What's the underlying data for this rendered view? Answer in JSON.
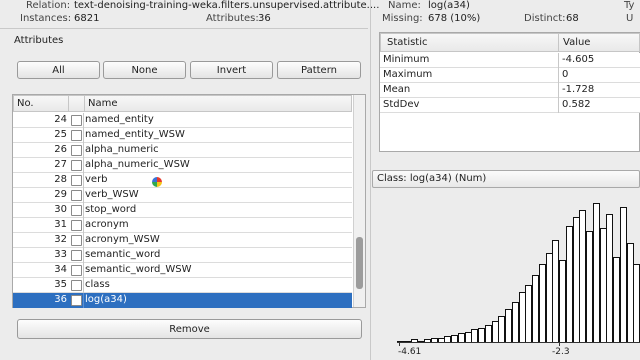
{
  "relation": {
    "label": "Relation:",
    "value": "text-denoising-training-weka.filters.unsupervised.attribute...."
  },
  "instances": {
    "label": "Instances:",
    "value": "6821"
  },
  "attributes_count": {
    "label": "Attributes:",
    "value": "36"
  },
  "attributes_panel": {
    "title": "Attributes",
    "buttons": {
      "all": "All",
      "none": "None",
      "invert": "Invert",
      "pattern": "Pattern"
    },
    "columns": {
      "no": "No.",
      "name": "Name"
    },
    "rows": [
      {
        "no": "24",
        "name": "named_entity"
      },
      {
        "no": "25",
        "name": "named_entity_WSW"
      },
      {
        "no": "26",
        "name": "alpha_numeric"
      },
      {
        "no": "27",
        "name": "alpha_numeric_WSW"
      },
      {
        "no": "28",
        "name": "verb"
      },
      {
        "no": "29",
        "name": "verb_WSW"
      },
      {
        "no": "30",
        "name": "stop_word"
      },
      {
        "no": "31",
        "name": "acronym"
      },
      {
        "no": "32",
        "name": "acronym_WSW"
      },
      {
        "no": "33",
        "name": "semantic_word"
      },
      {
        "no": "34",
        "name": "semantic_word_WSW"
      },
      {
        "no": "35",
        "name": "class"
      },
      {
        "no": "36",
        "name": "log(a34)"
      }
    ],
    "selected_index": 12,
    "remove_label": "Remove"
  },
  "selected_attribute": {
    "name_label": "Name:",
    "name_value": "log(a34)",
    "type_label": "Ty",
    "missing_label": "Missing:",
    "missing_value": "678 (10%)",
    "distinct_label": "Distinct:",
    "distinct_value": "68",
    "unique_label": "U"
  },
  "stats_table": {
    "headers": [
      "Statistic",
      "Value"
    ],
    "rows": [
      {
        "stat": "Minimum",
        "value": "-4.605"
      },
      {
        "stat": "Maximum",
        "value": "0"
      },
      {
        "stat": "Mean",
        "value": "-1.728"
      },
      {
        "stat": "StdDev",
        "value": "0.582"
      }
    ]
  },
  "class_selector": {
    "value": "Class: log(a34) (Num)"
  },
  "histogram": {
    "x_tick_min": "-4.61",
    "x_tick_mid": "-2.3",
    "bar_heights_fraction": [
      0.01,
      0.01,
      0.02,
      0.01,
      0.02,
      0.03,
      0.03,
      0.04,
      0.05,
      0.06,
      0.07,
      0.09,
      0.1,
      0.12,
      0.15,
      0.18,
      0.23,
      0.28,
      0.35,
      0.4,
      0.47,
      0.55,
      0.63,
      0.72,
      0.58,
      0.82,
      0.88,
      0.93,
      0.78,
      0.98,
      0.8,
      0.9,
      0.6,
      0.95,
      0.7,
      0.55
    ]
  },
  "colors": {
    "selection": "#2d6fc0"
  }
}
